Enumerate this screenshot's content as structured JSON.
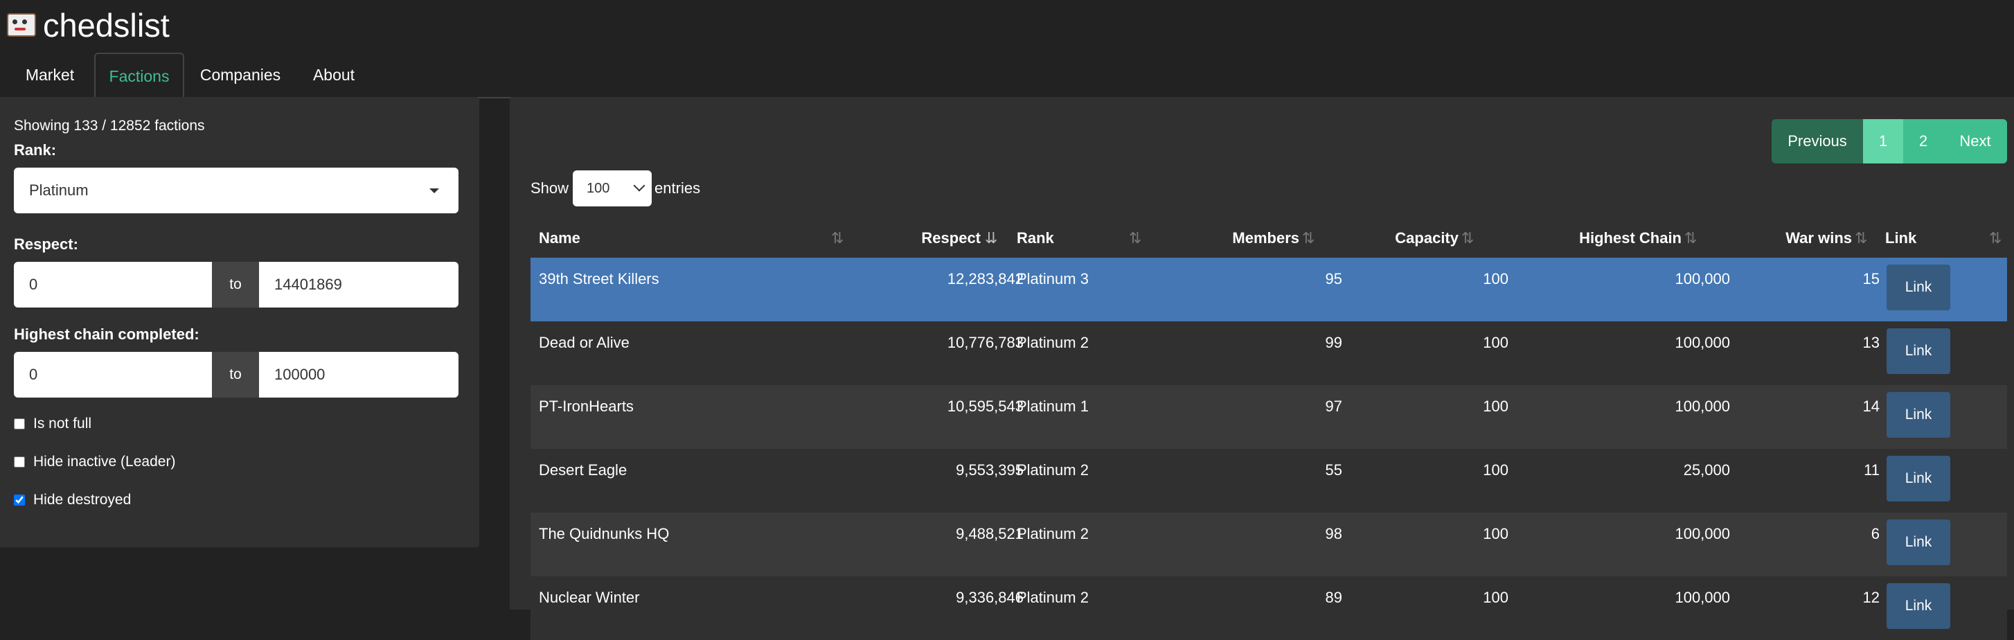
{
  "brand": {
    "name": "chedslist",
    "logo_icon": "troll-face-icon"
  },
  "tabs": [
    {
      "label": "Market",
      "active": false
    },
    {
      "label": "Factions",
      "active": true
    },
    {
      "label": "Companies",
      "active": false
    },
    {
      "label": "About",
      "active": false
    }
  ],
  "colors": {
    "background": "#222222",
    "panel": "#303030",
    "accent": "#3fbf8f",
    "selected_row": "#4477b3",
    "link_button": "#375a7f"
  },
  "filters": {
    "summary": "Showing 133 / 12852 factions",
    "rank_label": "Rank:",
    "rank_value": "Platinum",
    "respect_label": "Respect:",
    "respect_min": "0",
    "respect_to": "to",
    "respect_max": "14401869",
    "chain_label": "Highest chain completed:",
    "chain_min": "0",
    "chain_to": "to",
    "chain_max": "100000",
    "checkboxes": [
      {
        "label": "Is not full",
        "checked": false
      },
      {
        "label": "Hide inactive (Leader)",
        "checked": false
      },
      {
        "label": "Hide destroyed",
        "checked": true
      }
    ]
  },
  "pagination": {
    "previous": "Previous",
    "page1": "1",
    "page2": "2",
    "next": "Next"
  },
  "entries": {
    "show": "Show",
    "value": "100",
    "entries": "entries"
  },
  "table": {
    "headers": {
      "name": "Name",
      "respect": "Respect",
      "rank": "Rank",
      "members": "Members",
      "capacity": "Capacity",
      "highest_chain": "Highest Chain",
      "war_wins": "War wins",
      "link": "Link"
    },
    "sort_icon": "⇅",
    "sort_active_icon": "⇊",
    "rows": [
      {
        "name": "39th Street Killers",
        "respect": "12,283,842",
        "rank": "Platinum 3",
        "members": "95",
        "capacity": "100",
        "highest_chain": "100,000",
        "war_wins": "15",
        "link": "Link"
      },
      {
        "name": "Dead or Alive",
        "respect": "10,776,783",
        "rank": "Platinum 2",
        "members": "99",
        "capacity": "100",
        "highest_chain": "100,000",
        "war_wins": "13",
        "link": "Link"
      },
      {
        "name": "PT-IronHearts",
        "respect": "10,595,543",
        "rank": "Platinum 1",
        "members": "97",
        "capacity": "100",
        "highest_chain": "100,000",
        "war_wins": "14",
        "link": "Link"
      },
      {
        "name": "Desert Eagle",
        "respect": "9,553,395",
        "rank": "Platinum 2",
        "members": "55",
        "capacity": "100",
        "highest_chain": "25,000",
        "war_wins": "11",
        "link": "Link"
      },
      {
        "name": "The Quidnunks HQ",
        "respect": "9,488,521",
        "rank": "Platinum 2",
        "members": "98",
        "capacity": "100",
        "highest_chain": "100,000",
        "war_wins": "6",
        "link": "Link"
      },
      {
        "name": "Nuclear Winter",
        "respect": "9,336,846",
        "rank": "Platinum 2",
        "members": "89",
        "capacity": "100",
        "highest_chain": "100,000",
        "war_wins": "12",
        "link": "Link"
      }
    ]
  }
}
